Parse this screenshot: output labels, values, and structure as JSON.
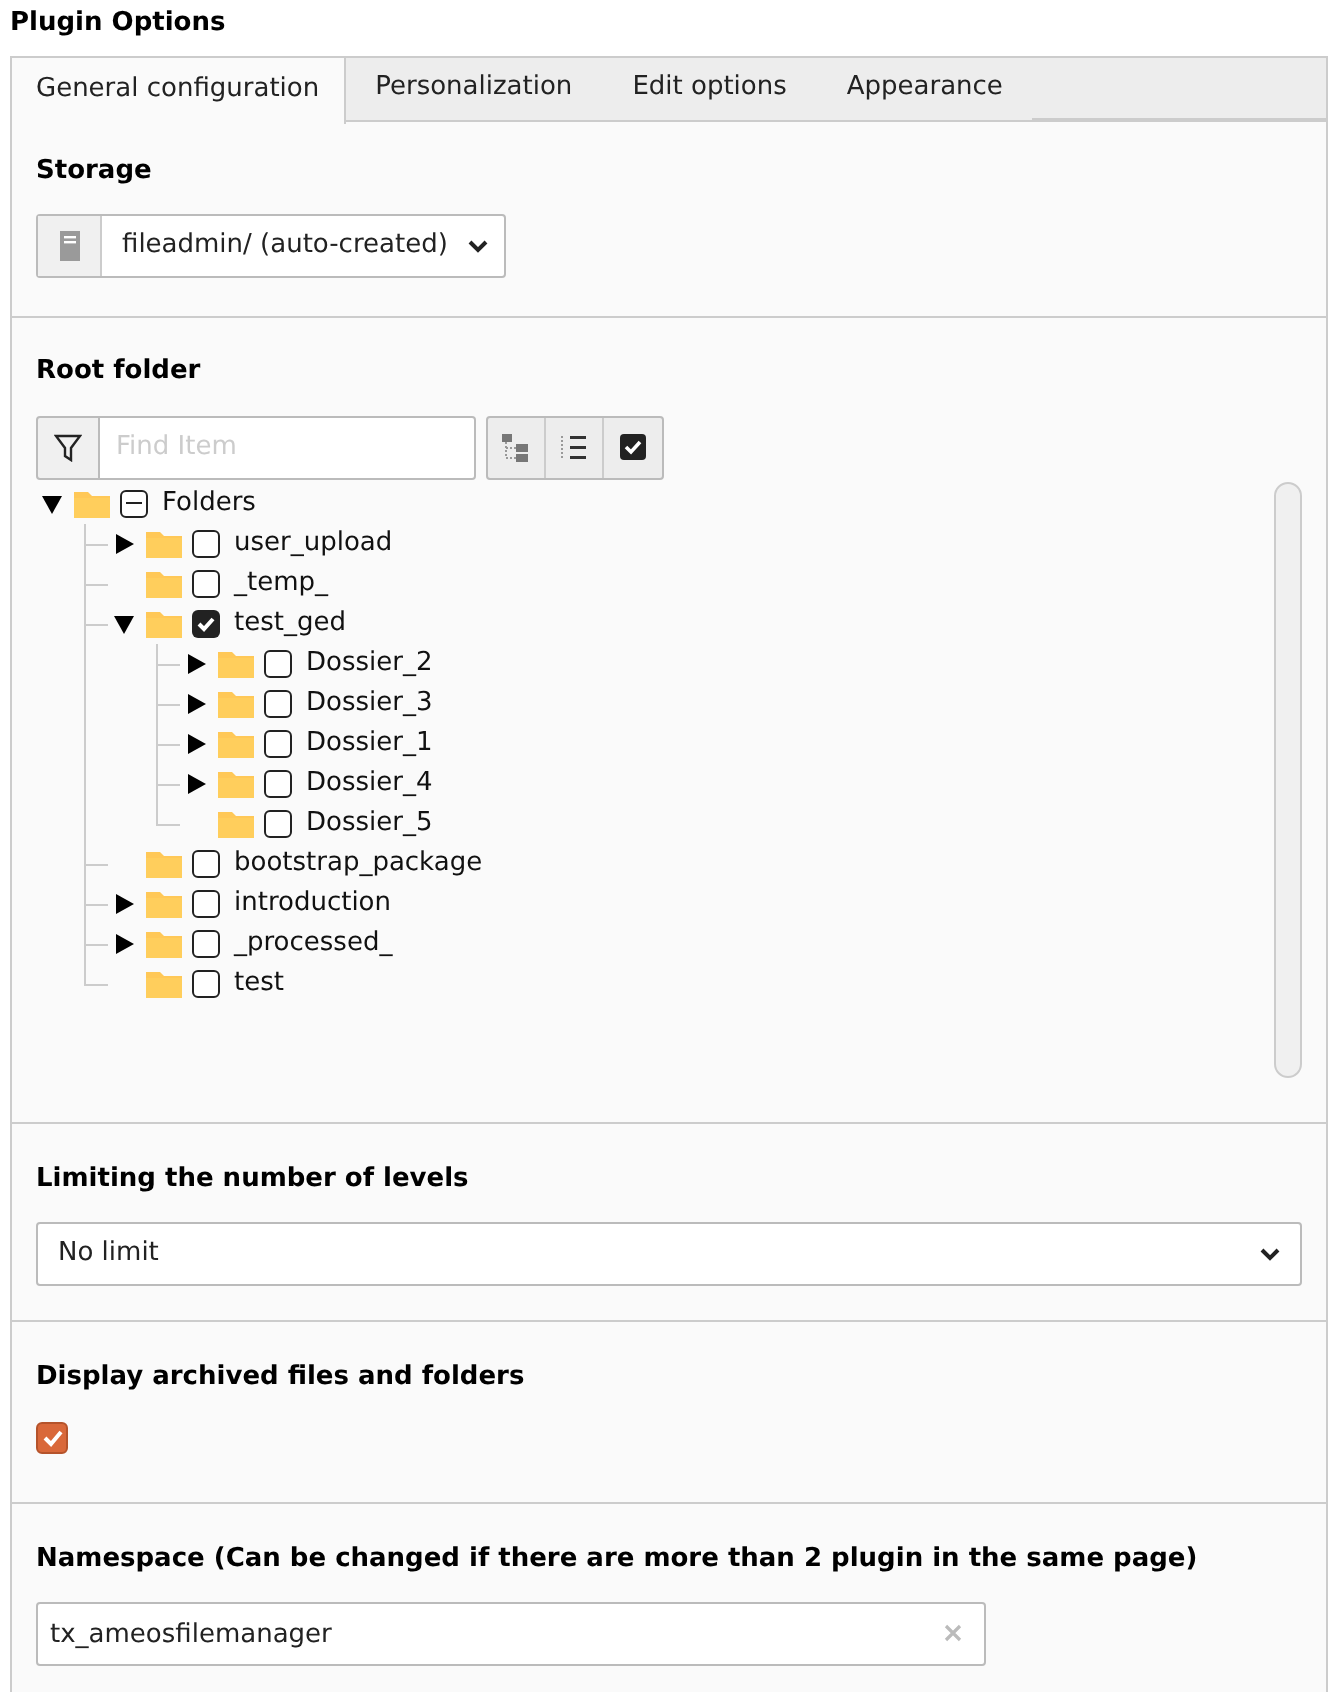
{
  "title": "Plugin Options",
  "tabs": [
    {
      "label": "General configuration",
      "selected": true
    },
    {
      "label": "Personalization",
      "selected": false
    },
    {
      "label": "Edit options",
      "selected": false
    },
    {
      "label": "Appearance",
      "selected": false
    }
  ],
  "storage": {
    "label": "Storage",
    "value": "fileadmin/ (auto-created)"
  },
  "root_folder": {
    "label": "Root folder",
    "search": {
      "placeholder": "Find Item"
    },
    "tree": [
      {
        "name": "Folders",
        "checked": false,
        "indeterminate": true,
        "expandable": true,
        "expanded": true,
        "children": [
          {
            "name": "user_upload",
            "checked": false,
            "indeterminate": false,
            "expandable": true,
            "expanded": false
          },
          {
            "name": "_temp_",
            "checked": false,
            "indeterminate": false,
            "expandable": false,
            "expanded": false
          },
          {
            "name": "test_ged",
            "checked": true,
            "indeterminate": false,
            "expandable": true,
            "expanded": true,
            "children": [
              {
                "name": "Dossier_2",
                "checked": false,
                "indeterminate": false,
                "expandable": true,
                "expanded": false
              },
              {
                "name": "Dossier_3",
                "checked": false,
                "indeterminate": false,
                "expandable": true,
                "expanded": false
              },
              {
                "name": "Dossier_1",
                "checked": false,
                "indeterminate": false,
                "expandable": true,
                "expanded": false
              },
              {
                "name": "Dossier_4",
                "checked": false,
                "indeterminate": false,
                "expandable": true,
                "expanded": false
              },
              {
                "name": "Dossier_5",
                "checked": false,
                "indeterminate": false,
                "expandable": false,
                "expanded": false
              }
            ]
          },
          {
            "name": "bootstrap_package",
            "checked": false,
            "indeterminate": false,
            "expandable": false,
            "expanded": false
          },
          {
            "name": "introduction",
            "checked": false,
            "indeterminate": false,
            "expandable": true,
            "expanded": false
          },
          {
            "name": "_processed_",
            "checked": false,
            "indeterminate": false,
            "expandable": true,
            "expanded": false
          },
          {
            "name": "test",
            "checked": false,
            "indeterminate": false,
            "expandable": false,
            "expanded": false
          }
        ]
      }
    ]
  },
  "levels": {
    "label": "Limiting the number of levels",
    "value": "No limit"
  },
  "archived": {
    "label": "Display archived files and folders",
    "checked": true
  },
  "namespace": {
    "label": "Namespace (Can be changed if there are more than 2 plugin in the same page)",
    "value": "tx_ameosfilemanager"
  }
}
